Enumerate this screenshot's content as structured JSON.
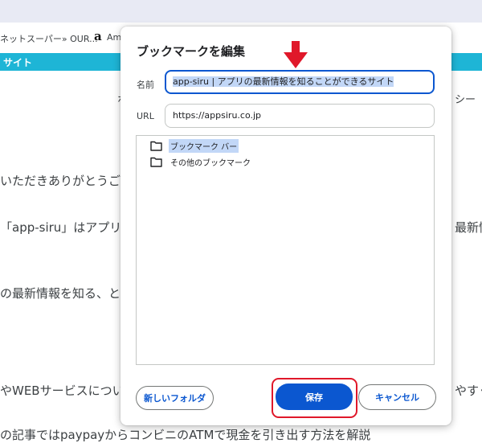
{
  "browser": {
    "bookmarks": {
      "item1": "ネットスーパー» OUR...",
      "item2": "Am"
    },
    "amazon_logo": "a"
  },
  "background": {
    "site_header": "サイト",
    "nav_right": "シー",
    "nav_left": "ホ",
    "lines": [
      "いただきありがとうご",
      "「app-siru」はアプリ",
      "最新情報",
      "の最新情報を知る、とい",
      "やWEBサービスについ",
      "やすく",
      "の記事ではpaypayからコンビニのATMで現金を引き出す方法を解説"
    ]
  },
  "dialog": {
    "title": "ブックマークを編集",
    "name_label": "名前",
    "name_value": "app-siru | アプリの最新情報を知ることができるサイト",
    "url_label": "URL",
    "url_value": "https://appsiru.co.jp",
    "folders": [
      {
        "label": "ブックマーク バー",
        "selected": true
      },
      {
        "label": "その他のブックマーク",
        "selected": false
      }
    ],
    "new_folder_label": "新しいフォルダ",
    "save_label": "保存",
    "cancel_label": "キャンセル"
  },
  "colors": {
    "accent": "#0b57d0",
    "annotation_red": "#e0182a",
    "site_header": "#1eb5d6"
  }
}
